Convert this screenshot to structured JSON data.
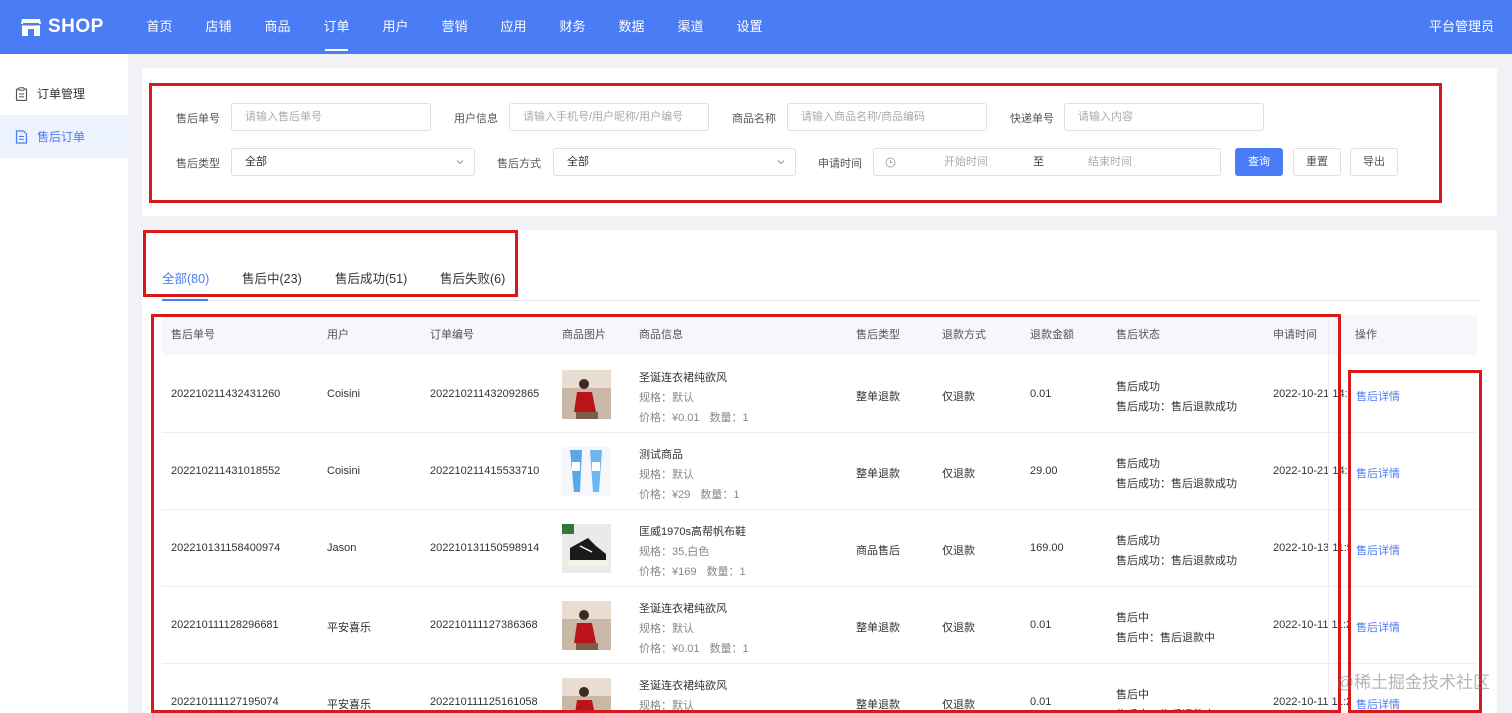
{
  "brand": {
    "name": "SHOP",
    "accent": "#4a7cf6",
    "annotation_color": "#d7191c"
  },
  "nav": {
    "items": [
      "首页",
      "店铺",
      "商品",
      "订单",
      "用户",
      "营销",
      "应用",
      "财务",
      "数据",
      "渠道",
      "设置"
    ],
    "active_index": 3,
    "user": "平台管理员"
  },
  "sidebar": {
    "items": [
      {
        "label": "订单管理",
        "icon": "clipboard-icon",
        "active": false
      },
      {
        "label": "售后订单",
        "icon": "document-icon",
        "active": true
      }
    ]
  },
  "filters": {
    "after_sale_no": {
      "label": "售后单号",
      "placeholder": "请输入售后单号"
    },
    "user_info": {
      "label": "用户信息",
      "placeholder": "请输入手机号/用户昵称/用户编号"
    },
    "product_name": {
      "label": "商品名称",
      "placeholder": "请输入商品名称/商品编码"
    },
    "express_no": {
      "label": "快递单号",
      "placeholder": "请输入内容"
    },
    "after_sale_type": {
      "label": "售后类型",
      "value": "全部"
    },
    "after_sale_method": {
      "label": "售后方式",
      "value": "全部"
    },
    "apply_time": {
      "label": "申请时间",
      "start": "开始时间",
      "separator": "至",
      "end": "结束时间"
    },
    "buttons": {
      "search": "查询",
      "reset": "重置",
      "export": "导出"
    }
  },
  "tabs": [
    {
      "label": "全部(80)",
      "active": true
    },
    {
      "label": "售后中(23)",
      "active": false
    },
    {
      "label": "售后成功(51)",
      "active": false
    },
    {
      "label": "售后失败(6)",
      "active": false
    }
  ],
  "table": {
    "headers": {
      "after_sale_no": "售后单号",
      "user": "用户",
      "order_no": "订单编号",
      "image": "商品图片",
      "info": "商品信息",
      "type": "售后类型",
      "refund_method": "退款方式",
      "amount": "退款金额",
      "status": "售后状态",
      "apply_time": "申请时间",
      "action": "操作"
    },
    "rows": [
      {
        "after_sale_no": "202210211432431260",
        "user": "Coisini",
        "order_no": "202210211432092865",
        "image": "red-dress",
        "product": "圣诞连衣裙纯欲风",
        "spec": "规格：默认",
        "price": "价格：¥0.01",
        "qty": "数量：1",
        "type": "整单退款",
        "refund_method": "仅退款",
        "amount": "0.01",
        "status": "售后成功",
        "status_detail": "售后成功：售后退款成功",
        "apply_time": "2022-10-21 14:3",
        "action": "售后详情"
      },
      {
        "after_sale_no": "202210211431018552",
        "user": "Coisini",
        "order_no": "202210211415533710",
        "image": "blue-tubes",
        "product": "测试商品",
        "spec": "规格：默认",
        "price": "价格：¥29",
        "qty": "数量：1",
        "type": "整单退款",
        "refund_method": "仅退款",
        "amount": "29.00",
        "status": "售后成功",
        "status_detail": "售后成功：售后退款成功",
        "apply_time": "2022-10-21 14:3",
        "action": "售后详情"
      },
      {
        "after_sale_no": "202210131158400974",
        "user": "Jason",
        "order_no": "202210131150598914",
        "image": "sneaker",
        "product": "匡威1970s高帮帆布鞋",
        "spec": "规格：35,白色",
        "price": "价格：¥169",
        "qty": "数量：1",
        "type": "商品售后",
        "refund_method": "仅退款",
        "amount": "169.00",
        "status": "售后成功",
        "status_detail": "售后成功：售后退款成功",
        "apply_time": "2022-10-13 11:5",
        "action": "售后详情"
      },
      {
        "after_sale_no": "202210111128296681",
        "user": "平安喜乐",
        "order_no": "202210111127386368",
        "image": "red-dress",
        "product": "圣诞连衣裙纯欲风",
        "spec": "规格：默认",
        "price": "价格：¥0.01",
        "qty": "数量：1",
        "type": "整单退款",
        "refund_method": "仅退款",
        "amount": "0.01",
        "status": "售后中",
        "status_detail": "售后中：售后退款中",
        "apply_time": "2022-10-11 11:2",
        "action": "售后详情"
      },
      {
        "after_sale_no": "202210111127195074",
        "user": "平安喜乐",
        "order_no": "202210111125161058",
        "image": "red-dress",
        "product": "圣诞连衣裙纯欲风",
        "spec": "规格：默认",
        "price": "",
        "qty": "",
        "type": "整单退款",
        "refund_method": "仅退款",
        "amount": "0.01",
        "status": "售后中",
        "status_detail": "售后中：售后退款中",
        "apply_time": "2022-10-11 11:2",
        "action": "售后详情"
      }
    ]
  },
  "watermark": "@稀土掘金技术社区"
}
